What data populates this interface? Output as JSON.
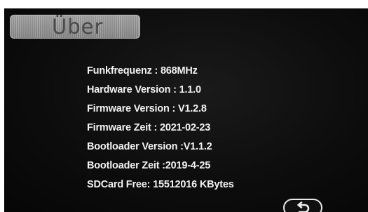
{
  "header": {
    "title": "Über"
  },
  "info": [
    "Funkfrequenz : 868MHz",
    "Hardware Version : 1.1.0",
    "Firmware Version : V1.2.8",
    "Firmware Zeit : 2021-02-23",
    "Bootloader Version :V1.1.2",
    "Bootloader Zeit :2019-4-25",
    "SDCard Free: 15512016 KBytes"
  ],
  "footer": {
    "back_icon": "return-arrow-icon"
  },
  "colors": {
    "background": "#0d0d0d",
    "text": "#f2f2f2",
    "title_tab": "#9e9e9e",
    "title_text": "#4a4a4a"
  }
}
